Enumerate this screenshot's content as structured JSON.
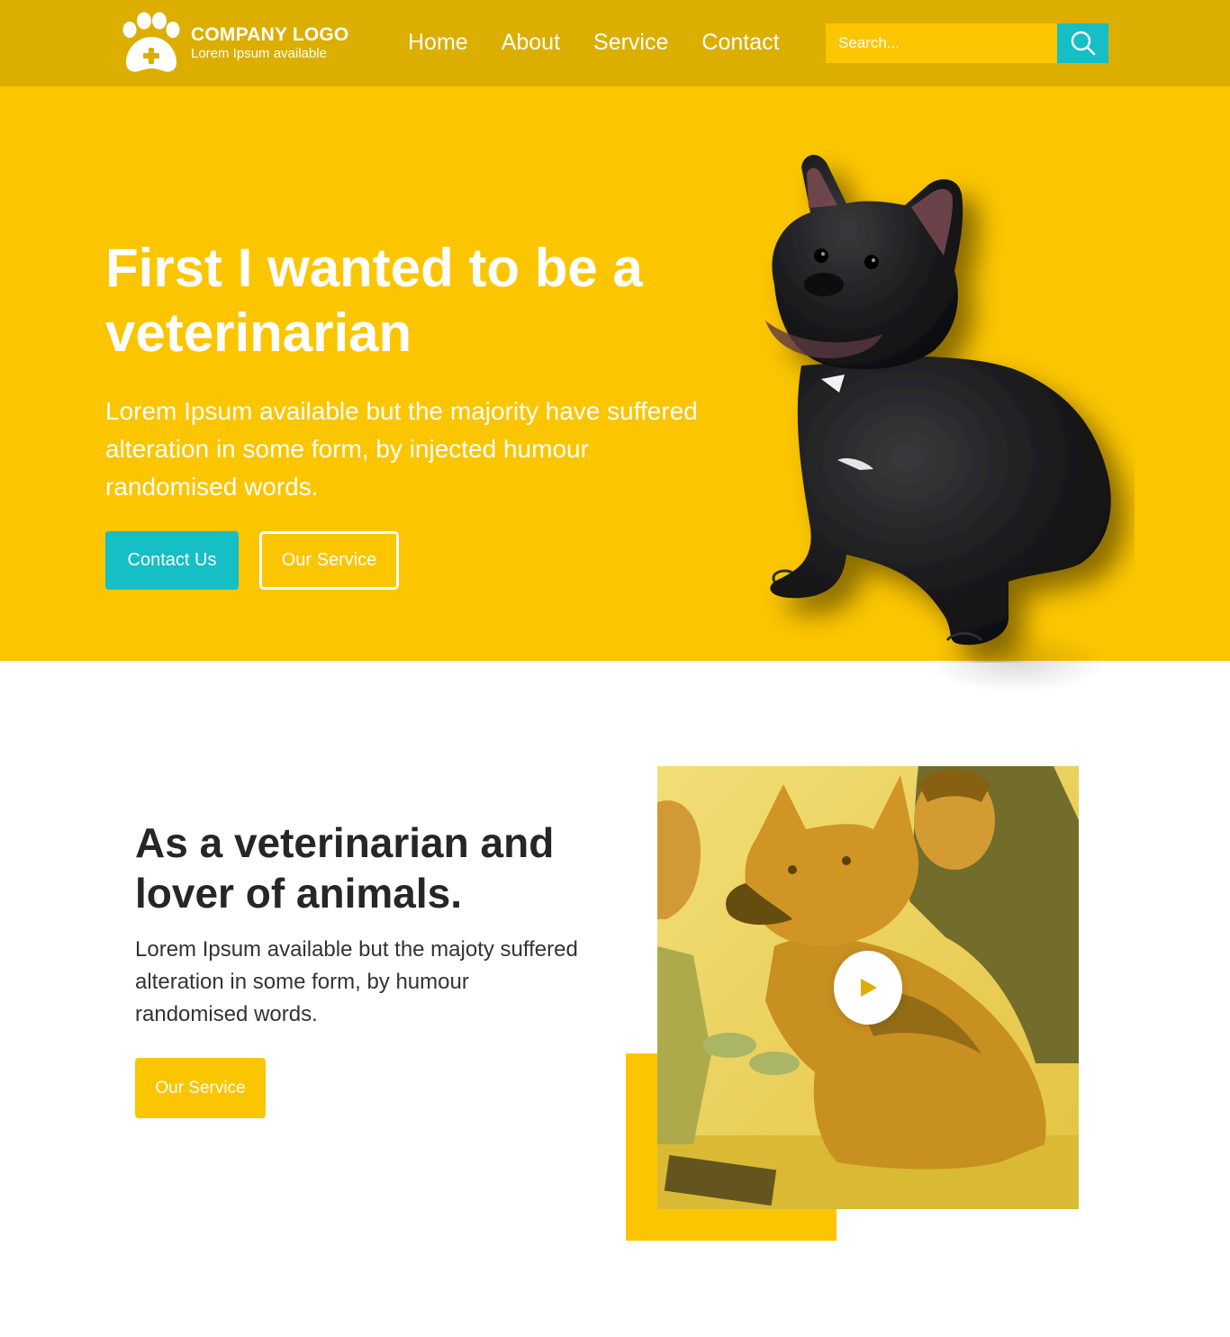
{
  "header": {
    "logo": {
      "title": "COMPANY LOGO",
      "subtitle": "Lorem Ipsum available",
      "icon": "paw-plus-icon"
    },
    "nav": [
      {
        "label": "Home"
      },
      {
        "label": "About"
      },
      {
        "label": "Service"
      },
      {
        "label": "Contact"
      }
    ],
    "search": {
      "placeholder": "Search...",
      "icon": "search-icon"
    }
  },
  "hero": {
    "title": "First I wanted to be a veterinarian",
    "text": "Lorem Ipsum available but the majority have suffered alteration in some form, by injected humour randomised words.",
    "primary_button": "Contact Us",
    "secondary_button": "Our Service",
    "image": "black-french-bulldog"
  },
  "about": {
    "title": "As a veterinarian and lover of animals.",
    "text": "Lorem Ipsum available but the majoty suffered alteration in some form, by humour randomised words.",
    "button": "Our Service",
    "video": {
      "image": "vets-examining-german-shepherd",
      "icon": "play-icon"
    }
  },
  "colors": {
    "header_bg": "#dcae00",
    "brand_yellow": "#fbc500",
    "accent_teal": "#16bec6",
    "heading_dark": "#262626"
  }
}
